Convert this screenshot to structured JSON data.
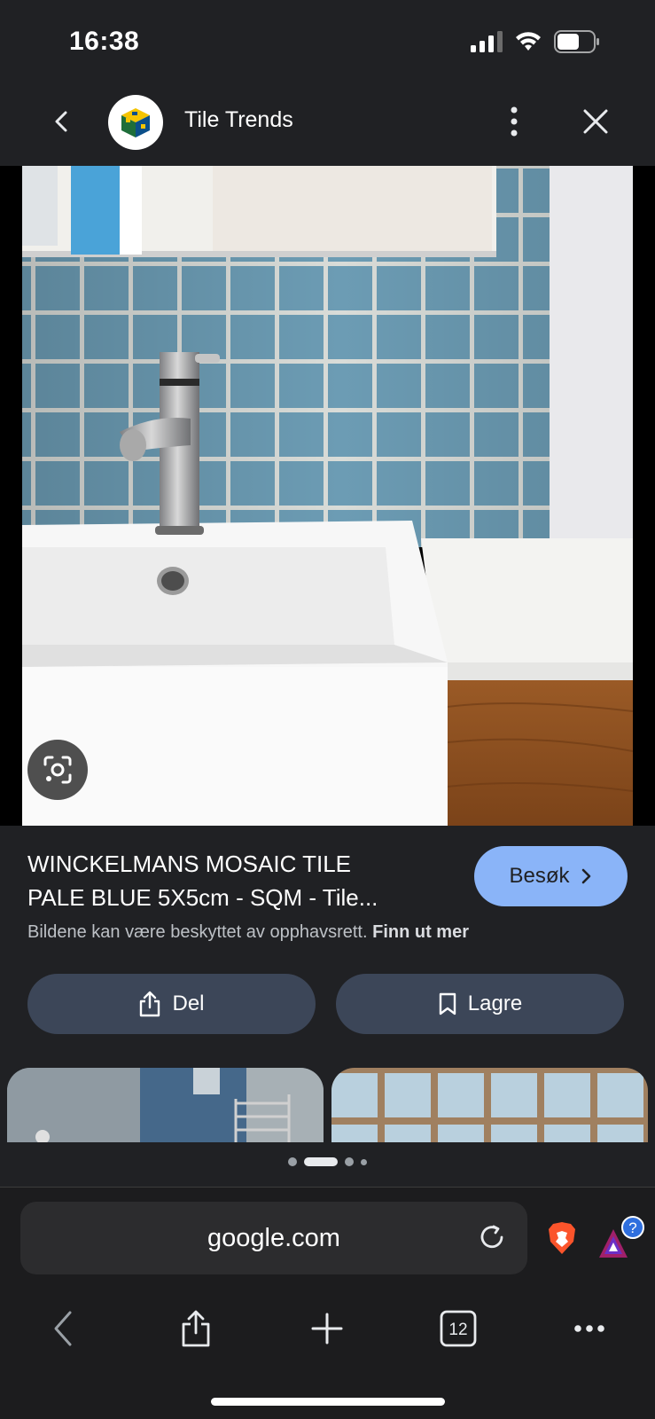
{
  "status_bar": {
    "time": "16:38"
  },
  "header": {
    "site_name": "Tile Trends",
    "back_icon": "chevron-left-icon",
    "more_icon": "more-vert-icon",
    "close_icon": "close-icon"
  },
  "result": {
    "title_line1": "WINCKELMANS MOSAIC TILE",
    "title_line2": "PALE BLUE 5X5cm - SQM - Tile...",
    "visit_label": "Besøk",
    "copyright_text": "Bildene kan være beskyttet av opphavsrett.",
    "learn_more": "Finn ut mer",
    "share_label": "Del",
    "save_label": "Lagre"
  },
  "pager": {
    "count": 4,
    "active_index": 1
  },
  "browser": {
    "url": "google.com",
    "tab_count": "12",
    "rewards_badge": "?"
  },
  "colors": {
    "background": "#202124",
    "accent": "#8ab4f8",
    "action_button": "#3c4658",
    "tile_blue": "#6c9cb4"
  }
}
